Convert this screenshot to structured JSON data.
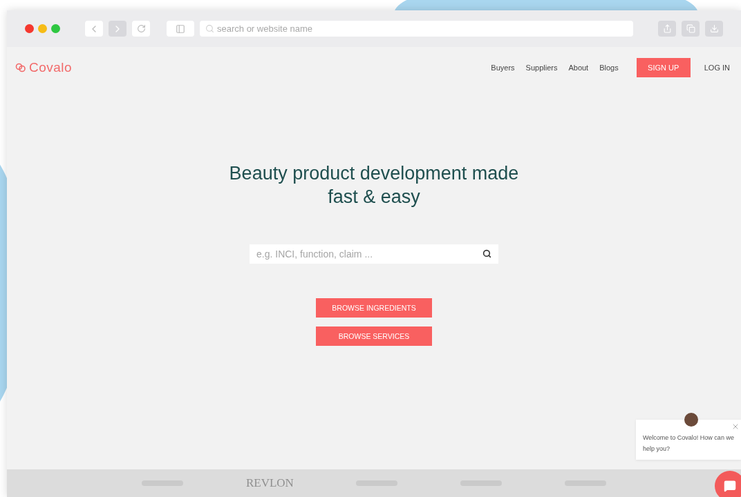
{
  "browser": {
    "address_placeholder": "search or website name"
  },
  "nav": {
    "logo": "Covalo",
    "links": [
      "Buyers",
      "Suppliers",
      "About",
      "Blogs"
    ],
    "signup": "SIGN UP",
    "login": "LOG IN"
  },
  "hero": {
    "title": "Beauty product development made fast & easy",
    "search_placeholder": "e.g. INCI, function, claim ...",
    "buttons": [
      "BROWSE INGREDIENTS",
      "BROWSE SERVICES"
    ]
  },
  "chat": {
    "message": "Welcome to Covalo! How can we help you?"
  },
  "logos": [
    {
      "kind": "mark"
    },
    {
      "kind": "word",
      "text": "REVLON"
    },
    {
      "kind": "mark"
    },
    {
      "kind": "mark"
    },
    {
      "kind": "mark"
    }
  ]
}
